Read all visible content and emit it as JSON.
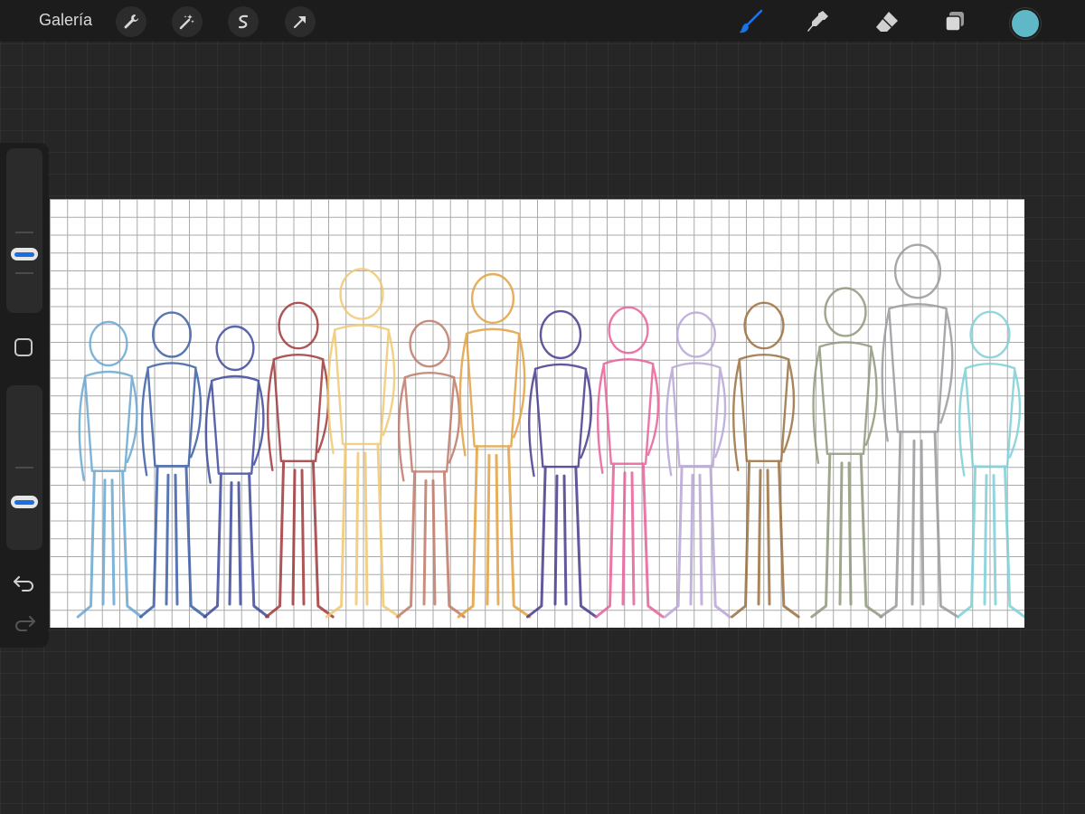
{
  "toolbar": {
    "gallery_label": "Galería",
    "tools_left": [
      "wrench-icon",
      "magic-wand-icon",
      "selection-s-icon",
      "transform-arrow-icon"
    ],
    "tools_right": [
      "brush-icon",
      "smudge-icon",
      "eraser-icon",
      "layers-icon"
    ],
    "active_tool": "brush",
    "active_tool_color": "#1a73e8",
    "current_color": "#5fb8c8"
  },
  "sidebar": {
    "brush_size_level": 0.45,
    "opacity_level": 0.75,
    "icons": [
      "modify-square-icon",
      "undo-icon",
      "redo-icon"
    ]
  },
  "canvas": {
    "background": "#ffffff",
    "grid_color": "#a9a9a9",
    "figure_colors": [
      "#6aa7d1",
      "#3c5fa6",
      "#3d4a9c",
      "#a0383a",
      "#f0c872",
      "#c07a6a",
      "#e3a040",
      "#4a3a8c",
      "#e8609a",
      "#b8a6d8",
      "#9b7040",
      "#8f9a7c",
      "#9a9a9e",
      "#7ed0d8"
    ]
  }
}
